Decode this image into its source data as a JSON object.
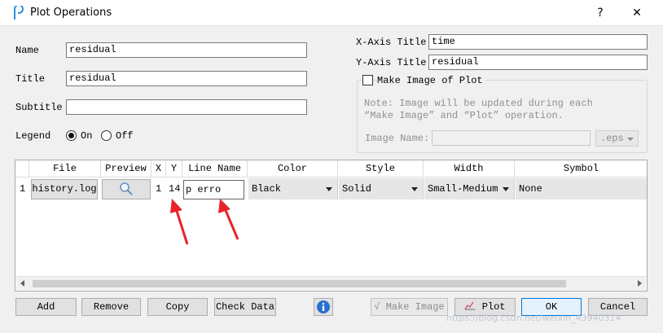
{
  "window": {
    "title": "Plot Operations",
    "help": "?",
    "close": "✕"
  },
  "form": {
    "name_label": "Name",
    "name_value": "residual",
    "title_label": "Title",
    "title_value": "residual",
    "subtitle_label": "Subtitle",
    "subtitle_value": "",
    "legend_label": "Legend",
    "legend_on": "On",
    "legend_off": "Off",
    "legend_selected": "On",
    "xaxis_label": "X-Axis Title",
    "xaxis_value": "time",
    "yaxis_label": "Y-Axis Title",
    "yaxis_value": "residual",
    "make_image_label": "Make Image of Plot",
    "make_image_checked": false,
    "note_line1": "Note: Image will be updated during each",
    "note_line2": "“Make Image” and “Plot” operation.",
    "image_name_label": "Image Name:",
    "image_name_value": "",
    "image_format": ".eps"
  },
  "table": {
    "columns": [
      "File",
      "Preview",
      "X",
      "Y",
      "Line Name",
      "Color",
      "Style",
      "Width",
      "Symbol"
    ],
    "rows": [
      {
        "index": "1",
        "file": "history.log",
        "x": "1",
        "y": "14",
        "line_name": "p erro",
        "color": "Black",
        "style": "Solid",
        "width": "Small-Medium",
        "symbol": "None"
      }
    ]
  },
  "buttons": {
    "add": "Add",
    "remove": "Remove",
    "copy": "Copy",
    "check_data": "Check Data",
    "make_image": "Make Image",
    "plot": "Plot",
    "ok": "OK",
    "cancel": "Cancel"
  },
  "watermark": "https://blog.csdn.net/weixin_43940314",
  "colors": {
    "accent": "#0078d7",
    "arrow": "#e8232a",
    "app_icon": "#2a8ee8"
  }
}
